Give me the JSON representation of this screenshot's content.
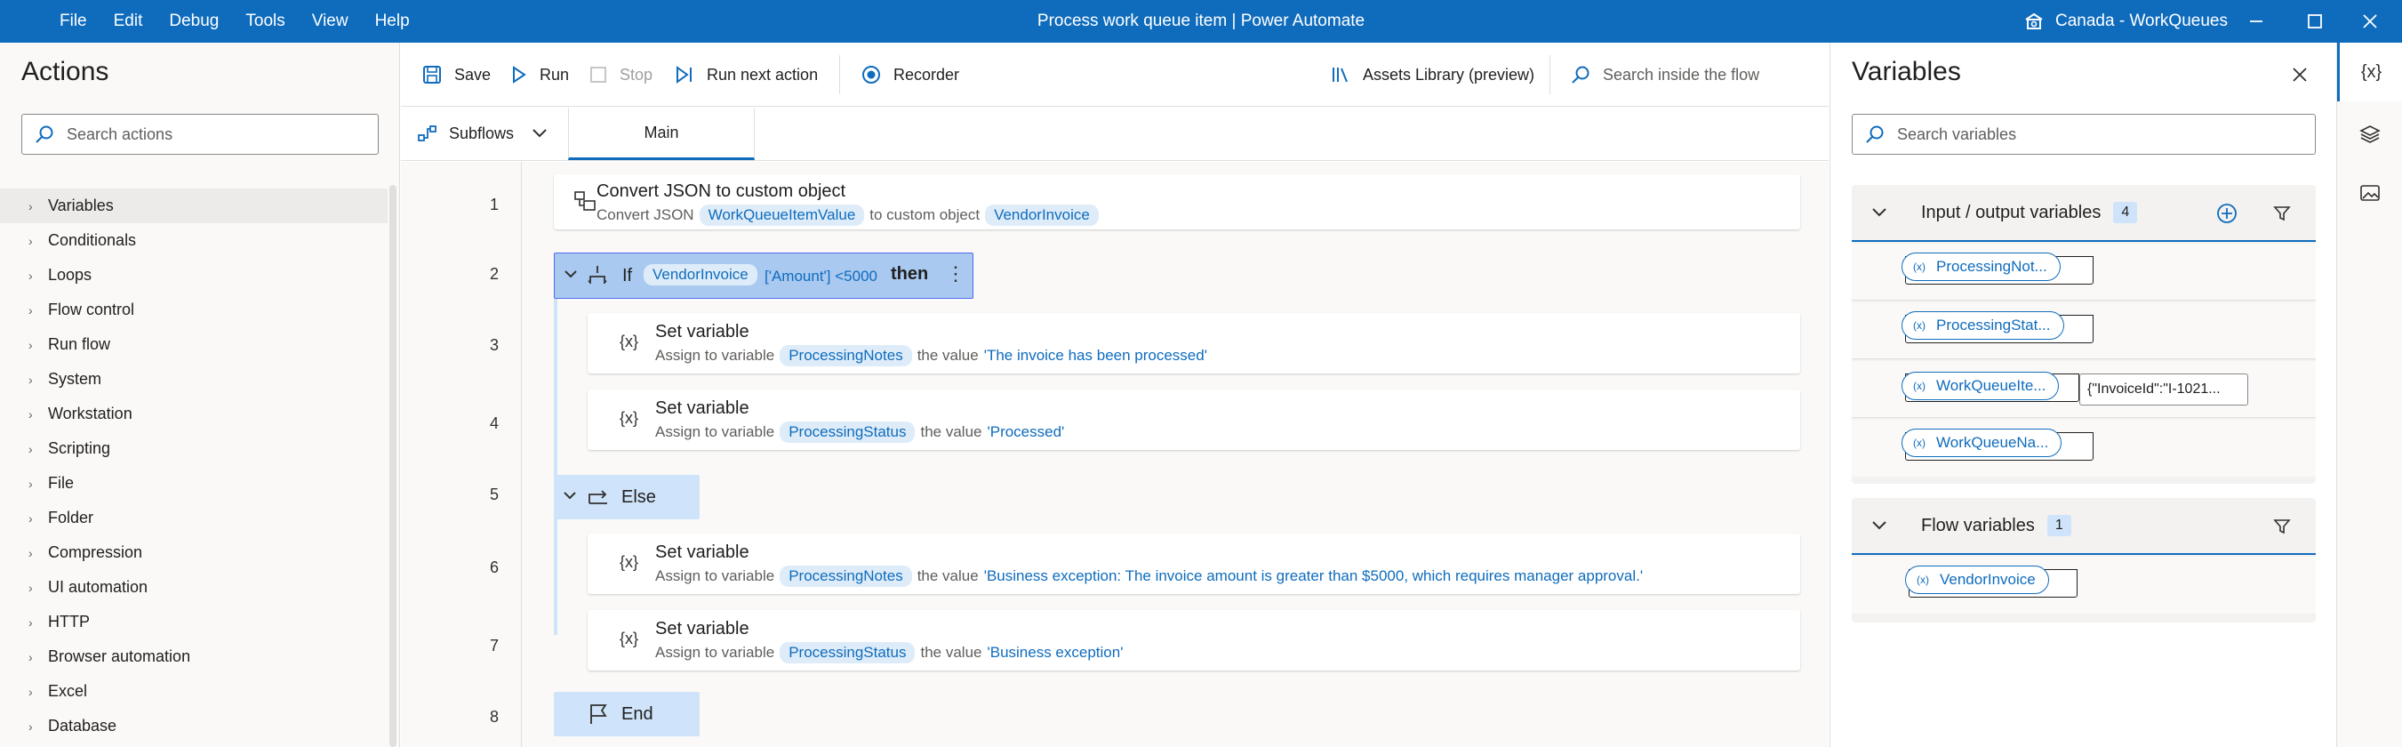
{
  "window": {
    "title": "Process work queue item | Power Automate",
    "environment": "Canada - WorkQueues",
    "menu": [
      "File",
      "Edit",
      "Debug",
      "Tools",
      "View",
      "Help"
    ]
  },
  "actions_panel": {
    "title": "Actions",
    "search_placeholder": "Search actions",
    "categories": [
      "Variables",
      "Conditionals",
      "Loops",
      "Flow control",
      "Run flow",
      "System",
      "Workstation",
      "Scripting",
      "File",
      "Folder",
      "Compression",
      "UI automation",
      "HTTP",
      "Browser automation",
      "Excel",
      "Database"
    ]
  },
  "toolbar": {
    "save": "Save",
    "run": "Run",
    "stop": "Stop",
    "run_next": "Run next action",
    "recorder": "Recorder",
    "assets": "Assets Library (preview)",
    "search_flow_placeholder": "Search inside the flow"
  },
  "tabs": {
    "subflows": "Subflows",
    "main": "Main"
  },
  "flow": {
    "line_numbers": [
      "1",
      "2",
      "3",
      "4",
      "5",
      "6",
      "7",
      "8"
    ],
    "step1": {
      "title": "Convert JSON to custom object",
      "prefix": "Convert JSON",
      "var1": "WorkQueueItemValue",
      "mid": "to custom object",
      "var2": "VendorInvoice"
    },
    "if_block": {
      "keyword": "If",
      "var": "VendorInvoice",
      "expr": "['Amount'] <5000",
      "then": "then"
    },
    "step3": {
      "title": "Set variable",
      "prefix": "Assign to variable",
      "var": "ProcessingNotes",
      "mid": "the value",
      "value": "'The invoice has been processed'"
    },
    "step4": {
      "title": "Set variable",
      "prefix": "Assign to variable",
      "var": "ProcessingStatus",
      "mid": "the value",
      "value": "'Processed'"
    },
    "else_label": "Else",
    "step6": {
      "title": "Set variable",
      "prefix": "Assign to variable",
      "var": "ProcessingNotes",
      "mid": "the value",
      "value": "'Business exception: The invoice amount is greater than $5000, which requires manager approval.'"
    },
    "step7": {
      "title": "Set variable",
      "prefix": "Assign to variable",
      "var": "ProcessingStatus",
      "mid": "the value",
      "value": "'Business exception'"
    },
    "end_label": "End"
  },
  "variables_panel": {
    "title": "Variables",
    "search_placeholder": "Search variables",
    "io_section": {
      "title": "Input / output variables",
      "count": "4",
      "items": [
        {
          "name": "ProcessingNot...",
          "value": ""
        },
        {
          "name": "ProcessingStat...",
          "value": ""
        },
        {
          "name": "WorkQueueIte...",
          "value": "{\"InvoiceId\":\"I-1021..."
        },
        {
          "name": "WorkQueueNa...",
          "value": ""
        }
      ]
    },
    "flow_section": {
      "title": "Flow variables",
      "count": "1",
      "items": [
        {
          "name": "VendorInvoice"
        }
      ]
    },
    "var_glyph": "(x)"
  },
  "rail": {
    "variables_glyph": "{x}"
  }
}
